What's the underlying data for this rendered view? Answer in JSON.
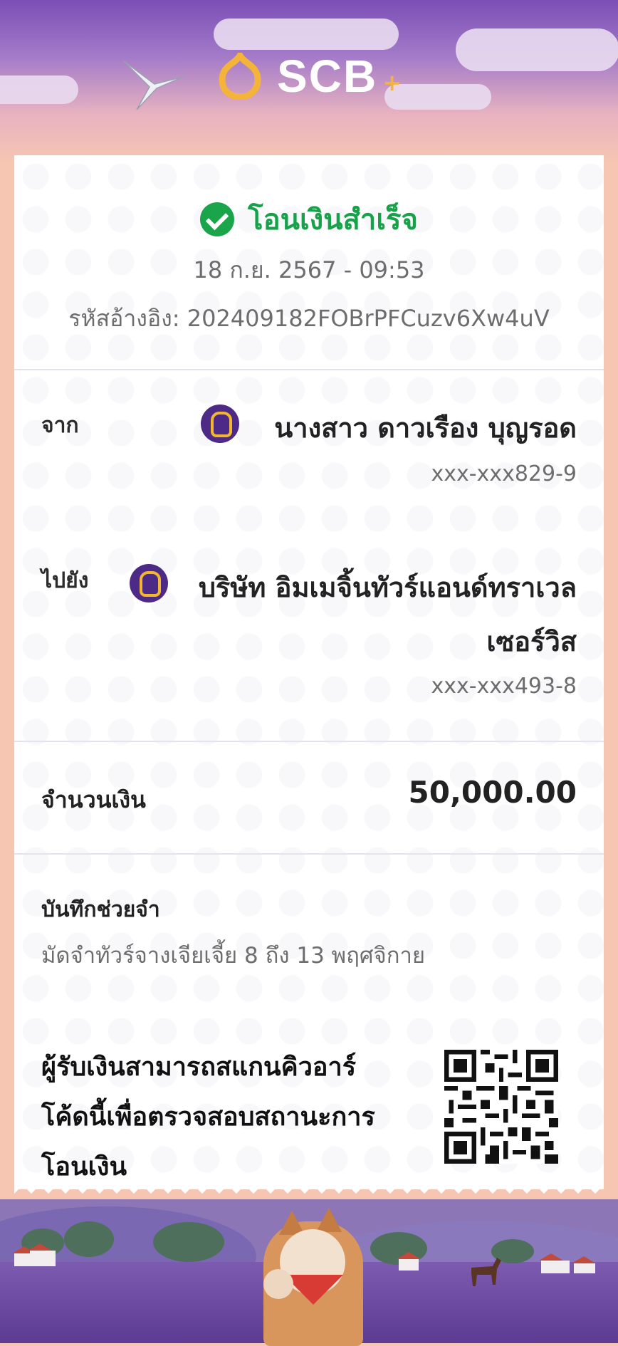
{
  "brand": {
    "name": "SCB",
    "plus": "+"
  },
  "status": {
    "text": "โอนเงินสำเร็จ",
    "color": "#17a24a"
  },
  "datetime": "18 ก.ย. 2567 - 09:53",
  "reference": {
    "label": "รหัสอ้างอิง:",
    "value": "202409182FOBrPFCuzv6Xw4uV"
  },
  "from": {
    "label": "จาก",
    "name": "นางสาว ดาวเรือง บุญรอด",
    "account": "xxx-xxx829-9"
  },
  "to": {
    "label": "ไปยัง",
    "name_line1": "บริษัท อิมเมจิ้นทัวร์แอนด์ทราเวล",
    "name_line2": "เซอร์วิส",
    "account": "xxx-xxx493-8"
  },
  "amount": {
    "label": "จำนวนเงิน",
    "value": "50,000.00"
  },
  "memo": {
    "label": "บันทึกช่วยจำ",
    "value": "มัดจำทัวร์จางเจียเจี้ย 8 ถึง 13 พฤศจิกาย"
  },
  "qr": {
    "line1": "ผู้รับเงินสามารถสแกนคิวอาร์",
    "line2": "โค้ดนี้เพื่อตรวจสอบสถานะการ",
    "line3": "โอนเงิน"
  },
  "colors": {
    "bank_purple": "#4d2a86",
    "bank_gold": "#f2b62f",
    "peach": "#f6c6b2"
  },
  "icons": [
    "check-circle-icon",
    "scb-logo-icon",
    "qr-code-icon"
  ]
}
